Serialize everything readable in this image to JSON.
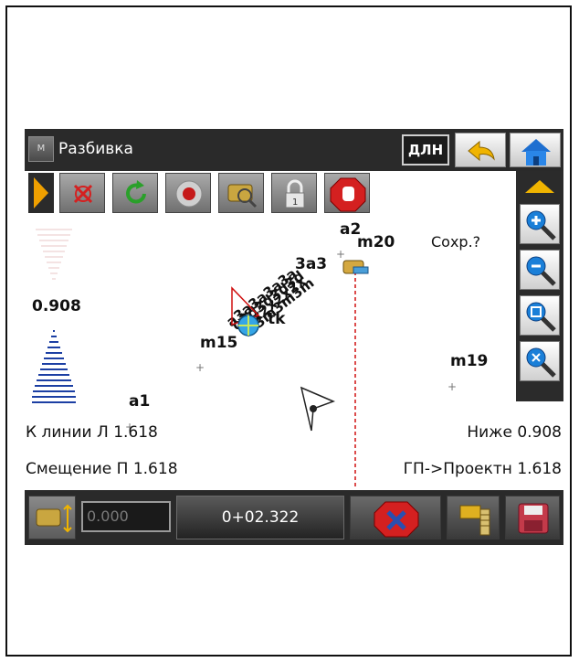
{
  "titlebar": {
    "menu_label": "M",
    "title": "Разбивка",
    "dln_label": "ДЛН"
  },
  "map": {
    "save_prompt": "Сохр.?",
    "height_value": "0.908",
    "points": {
      "a1": "a1",
      "a2": "a2",
      "m15": "m15",
      "m19": "m19",
      "m20": "m20",
      "tk": "tk",
      "cluster": "3a3"
    },
    "info": {
      "to_line": "К линии Л 1.618",
      "below": "Ниже 0.908",
      "offset": "Смещение П 1.618",
      "gp_project": "ГП->Проектн 1.618"
    }
  },
  "bottombar": {
    "input_value": "0.000",
    "station": "0+02.322"
  },
  "colors": {
    "titlebar": "#2a2a2a",
    "accent_blue": "#1c3fa3",
    "stop_red": "#d42020",
    "guide_red": "#d01010",
    "arrow_yellow": "#f0b400"
  }
}
